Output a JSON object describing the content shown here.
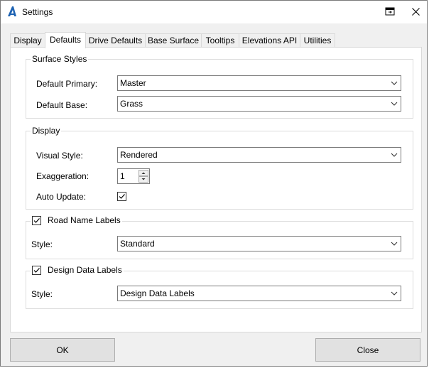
{
  "window": {
    "title": "Settings"
  },
  "tabs": [
    {
      "label": "Display"
    },
    {
      "label": "Defaults"
    },
    {
      "label": "Drive Defaults"
    },
    {
      "label": "Base Surface"
    },
    {
      "label": "Tooltips"
    },
    {
      "label": "Elevations API"
    },
    {
      "label": "Utilities"
    }
  ],
  "active_tab": "Defaults",
  "surface_styles": {
    "title": "Surface Styles",
    "primary_label": "Default Primary:",
    "primary_value": "Master",
    "base_label": "Default Base:",
    "base_value": "Grass"
  },
  "display": {
    "title": "Display",
    "visual_style_label": "Visual Style:",
    "visual_style_value": "Rendered",
    "exaggeration_label": "Exaggeration:",
    "exaggeration_value": "1",
    "auto_update_label": "Auto Update:",
    "auto_update_checked": true
  },
  "road_name_labels": {
    "title": "Road Name Labels",
    "enabled": true,
    "style_label": "Style:",
    "style_value": "Standard"
  },
  "design_data_labels": {
    "title": "Design Data Labels",
    "enabled": true,
    "style_label": "Style:",
    "style_value": "Design Data Labels"
  },
  "buttons": {
    "ok": "OK",
    "close": "Close"
  },
  "colors": {
    "accent": "#1e63b3",
    "panel": "#ffffff",
    "chrome": "#f0f0f0"
  }
}
